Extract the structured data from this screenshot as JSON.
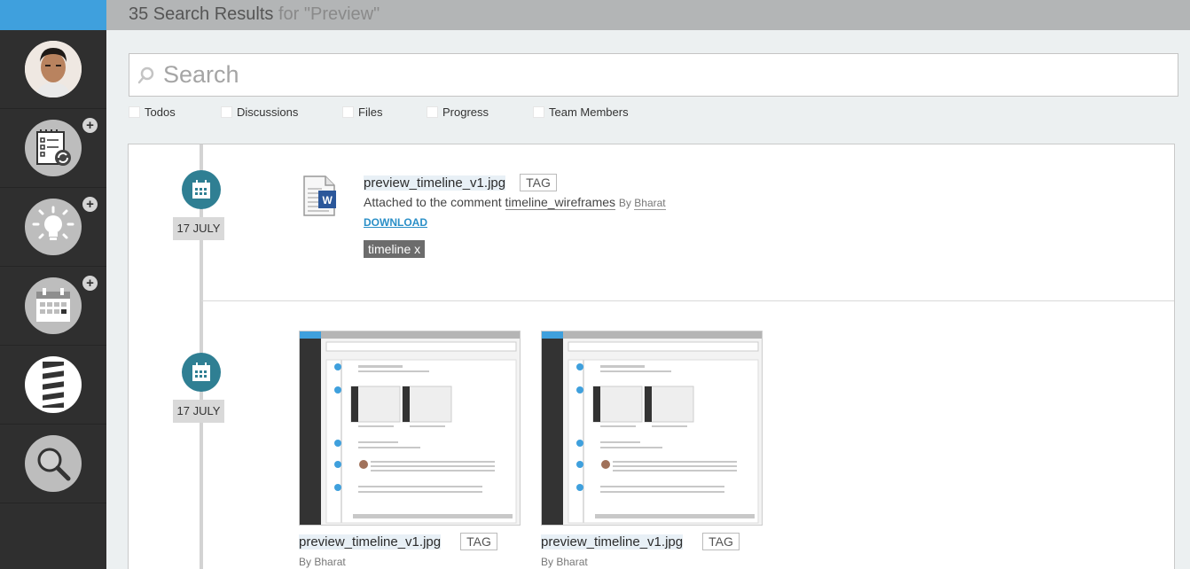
{
  "header": {
    "title_count": "35 Search Results",
    "title_query": "for \"Preview\""
  },
  "sidebar": {
    "items": [
      {
        "name": "user-avatar",
        "icon": "avatar"
      },
      {
        "name": "todos",
        "icon": "checklist-icon",
        "has_add": true
      },
      {
        "name": "ideas",
        "icon": "lightbulb-icon",
        "has_add": true
      },
      {
        "name": "calendar",
        "icon": "calendar-icon",
        "has_add": true
      },
      {
        "name": "notes",
        "icon": "notes-icon",
        "has_add": false
      },
      {
        "name": "search",
        "icon": "search-icon",
        "has_add": false
      }
    ],
    "add_symbol": "+"
  },
  "search": {
    "placeholder": "Search"
  },
  "filters": [
    "Todos",
    "Discussions",
    "Files",
    "Progress",
    "Team Members"
  ],
  "results": [
    {
      "date": "17 JULY",
      "file_name": "preview_timeline_v1.jpg",
      "tag_label": "TAG",
      "attached_prefix": "Attached to the comment",
      "attached_link": "timeline_wireframes",
      "by_prefix": "By",
      "author": "Bharat",
      "download_label": "DOWNLOAD",
      "chip_label": "timeline x"
    },
    {
      "date": "17 JULY",
      "thumbs": [
        {
          "file_name": "preview_timeline_v1.jpg",
          "tag_label": "TAG",
          "by_prefix": "By",
          "author": "Bharat"
        },
        {
          "file_name": "preview_timeline_v1.jpg",
          "tag_label": "TAG",
          "by_prefix": "By",
          "author": "Bharat"
        }
      ]
    }
  ],
  "colors": {
    "accent": "#3fa0dd",
    "sidebar": "#2f2f2f",
    "timeline_icon": "#2f7f93",
    "link": "#2a8fc7"
  }
}
